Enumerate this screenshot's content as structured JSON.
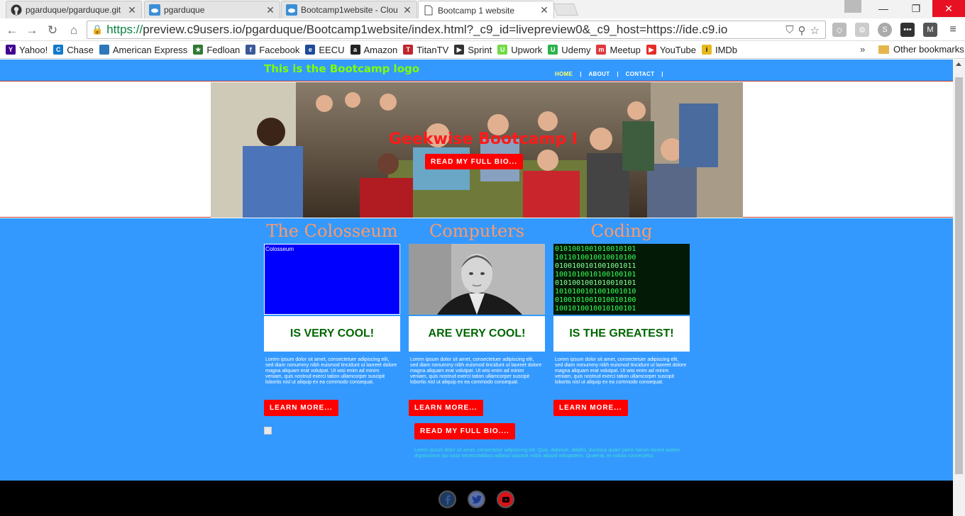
{
  "browser": {
    "tabs": [
      {
        "title": "pgarduque/pgarduque.git",
        "icon": "github-icon",
        "active": false
      },
      {
        "title": "pgarduque",
        "icon": "cloud9-icon",
        "active": false
      },
      {
        "title": "Bootcamp1website - Clou",
        "icon": "cloud9-icon",
        "active": false
      },
      {
        "title": "Bootcamp 1 website",
        "icon": "page-icon",
        "active": true
      }
    ],
    "url_scheme": "https://",
    "url_rest": "preview.c9users.io/pgarduque/Bootcamp1website/index.html?_c9_id=livepreview0&_c9_host=https://ide.c9.io",
    "bookmarks": [
      {
        "label": "Yahoo!",
        "color": "#400090",
        "glyph": "Y"
      },
      {
        "label": "Chase",
        "color": "#117aca",
        "glyph": "C"
      },
      {
        "label": "American Express",
        "color": "#2e77bb",
        "glyph": ""
      },
      {
        "label": "Fedloan",
        "color": "#2f7a32",
        "glyph": "★"
      },
      {
        "label": "Facebook",
        "color": "#3b5998",
        "glyph": "f"
      },
      {
        "label": "EECU",
        "color": "#1e4a9a",
        "glyph": "e"
      },
      {
        "label": "Amazon",
        "color": "#222222",
        "glyph": "a"
      },
      {
        "label": "TitanTV",
        "color": "#c0272d",
        "glyph": "T"
      },
      {
        "label": "Sprint",
        "color": "#333333",
        "glyph": "▶"
      },
      {
        "label": "Upwork",
        "color": "#6fda44",
        "glyph": "U"
      },
      {
        "label": "Udemy",
        "color": "#2bb24c",
        "glyph": "U"
      },
      {
        "label": "Meetup",
        "color": "#e0393e",
        "glyph": "m"
      },
      {
        "label": "YouTube",
        "color": "#e52d27",
        "glyph": "▶"
      },
      {
        "label": "IMDb",
        "color": "#e6b91e",
        "glyph": "i"
      }
    ],
    "other_bookmarks": "Other bookmarks",
    "more_chevron": "»"
  },
  "site": {
    "logo": "This is the Bootcamp logo",
    "nav": [
      {
        "label": "HOME",
        "active": true
      },
      {
        "label": "ABOUT",
        "active": false
      },
      {
        "label": "CONTACT",
        "active": false
      }
    ],
    "hero": {
      "title": "Geekwise Bootcamp I",
      "button": "READ MY FULL BIO..."
    },
    "columns": [
      {
        "heading": "The Colosseum",
        "image_alt": "Colosseum",
        "image_kind": "broken",
        "tag": "IS VERY COOL!",
        "text": "Lorem ipsum dolor sit amet, consectetuer adipiscing elit, sed diam nonummy nibh euismod tincidunt ut laoreet dolore magna aliquam erat volutpat. Ut wisi enim ad minim veniam, quis nostrud exerci tation ullamcorper suscipit lobortis nisl ut aliquip ex ea commodo consequat.",
        "button": "LEARN MORE..."
      },
      {
        "heading": "Computers",
        "image_alt": "",
        "image_kind": "portrait",
        "tag": "ARE VERY COOL!",
        "text": "Lorem ipsum dolor sit amet, consectetuer adipiscing elit, sed diam nonummy nibh euismod tincidunt ut laoreet dolore magna aliquam erat volutpat. Ut wisi enim ad minim veniam, quis nostrud exerci tation ullamcorper suscipit lobortis nisl ut aliquip ex ea commodo consequat.",
        "button": "LEARN MORE..."
      },
      {
        "heading": "Coding",
        "image_alt": "",
        "image_kind": "binary",
        "tag": "IS THE GREATEST!",
        "text": "Lorem ipsum dolor sit amet, consectetuer adipiscing elit, sed diam nonummy nibh euismod tincidunt ut laoreet dolore magna aliquam erat volutpat. Ut wisi enim ad minim veniam, quis nostrud exerci tation ullamcorper suscipit lobortis nisl ut aliquip ex ea commodo consequat.",
        "button": "LEARN MORE..."
      }
    ],
    "bio_button": "READ MY FULL BIO....",
    "bio_text": "Lorem ipsum dolor sit amet, consectetur adipisicing elit. Quis, dolorum, debitis, ducimus quam porro harum facere autem dignissimos qui iusto necessitatibus adipisci placeat nobis aliquid voluptatem. Quaerat, ex soluta consectetur.",
    "footer_social": [
      {
        "icon": "facebook-icon",
        "color": "#1e3a5f"
      },
      {
        "icon": "twitter-icon",
        "color": "#5b6fa8"
      },
      {
        "icon": "youtube-icon",
        "color": "#d7141a"
      }
    ]
  },
  "colors": {
    "header_blue": "#3399ff",
    "logo_green": "#7fff00",
    "accent_red": "#ff0000",
    "heading_orange": "#ff9966",
    "tag_green": "#006600",
    "bio_text_cyan": "#40e0d0"
  }
}
